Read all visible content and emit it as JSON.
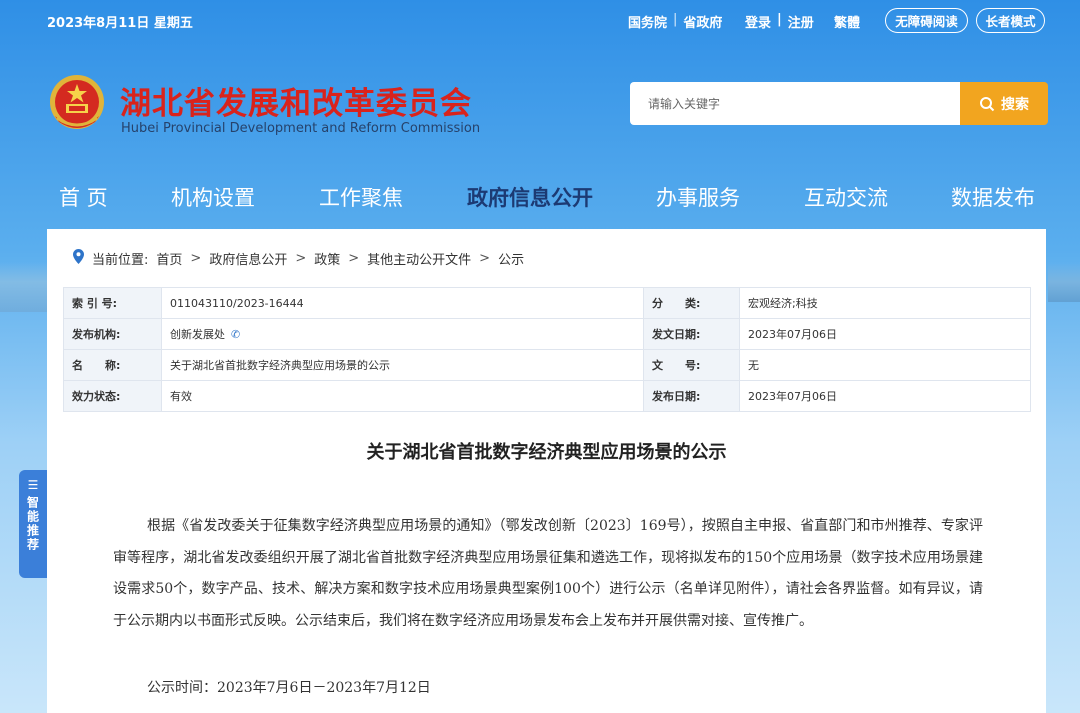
{
  "topbar": {
    "date": "2023年8月11日 星期五",
    "gov_links": [
      "国务院",
      "省政府"
    ],
    "account_links": [
      "登录",
      "注册"
    ],
    "traditional": "繁體",
    "accessible": "无障碍阅读",
    "elder_mode": "长者模式"
  },
  "header": {
    "title": "湖北省发展和改革委员会",
    "subtitle": "Hubei Provincial Development and Reform Commission"
  },
  "search": {
    "placeholder": "请输入关键字",
    "button": "搜索"
  },
  "nav": {
    "items": [
      "首 页",
      "机构设置",
      "工作聚焦",
      "政府信息公开",
      "办事服务",
      "互动交流",
      "数据发布"
    ],
    "active": "政府信息公开"
  },
  "breadcrumb": {
    "prefix": "当前位置:",
    "items": [
      "首页",
      "政府信息公开",
      "政策",
      "其他主动公开文件",
      "公示"
    ]
  },
  "meta": {
    "rows": [
      {
        "l1": "索 引 号:",
        "v1": "011043110/2023-16444",
        "l2": "分　　类:",
        "v2": "宏观经济;科技"
      },
      {
        "l1": "发布机构:",
        "v1": "创新发展处",
        "l2": "发文日期:",
        "v2": "2023年07月06日"
      },
      {
        "l1": "名　　称:",
        "v1": "关于湖北省首批数字经济典型应用场景的公示",
        "l2": "文　　号:",
        "v2": "无"
      },
      {
        "l1": "效力状态:",
        "v1": "有效",
        "l2": "发布日期:",
        "v2": "2023年07月06日"
      }
    ]
  },
  "article": {
    "title": "关于湖北省首批数字经济典型应用场景的公示",
    "body": "根据《省发改委关于征集数字经济典型应用场景的通知》（鄂发改创新〔2023〕169号），按照自主申报、省直部门和市州推荐、专家评审等程序，湖北省发改委组织开展了湖北省首批数字经济典型应用场景征集和遴选工作，现将拟发布的150个应用场景（数字技术应用场景建设需求50个，数字产品、技术、解决方案和数字技术应用场景典型案例100个）进行公示（名单详见附件），请社会各界监督。如有异议，请于公示期内以书面形式反映。公示结束后，我们将在数字经济应用场景发布会上发布并开展供需对接、宣传推广。",
    "time": "公示时间：2023年7月6日－2023年7月12日"
  },
  "sidetab": {
    "label": "智能推荐"
  },
  "colors": {
    "title_red": "#d9231c",
    "search_orange": "#f2a51f",
    "nav_active": "#1c3a73",
    "sidetab_blue": "#3b7fd9"
  }
}
